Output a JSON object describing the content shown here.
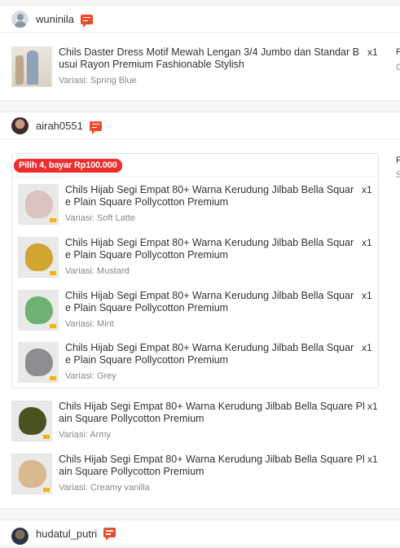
{
  "orders": [
    {
      "username": "wuninila",
      "side_label": "F",
      "side_sub": "C",
      "products": [
        {
          "name": "Chils Daster Dress Motif Mewah Lengan 3/4 Jumbo dan Standar Busui Rayon Premium Fashionable Stylish",
          "name_line1": "Chils Daster Dress Motif Mewah Lengan 3/4 Jumbo dan Standar B",
          "name_line2": "usui Rayon Premium Fashionable Stylish",
          "variant": "Variasi: Spring Blue",
          "qty": "x1",
          "color": "#8fa2b6"
        }
      ]
    },
    {
      "username": "airah0551",
      "side_label": "F",
      "side_sub": "S",
      "bundle": {
        "tag": "Pilih 4, bayar Rp100.000",
        "products": [
          {
            "name_line1": "Chils Hijab Segi Empat 80+ Warna Kerudung Jilbab Bella Squar",
            "name_line2": "e Plain Square Pollycotton Premium",
            "variant": "Variasi: Soft Latte",
            "qty": "x1",
            "color": "#d9c3bc"
          },
          {
            "name_line1": "Chils Hijab Segi Empat 80+ Warna Kerudung Jilbab Bella Squar",
            "name_line2": "e Plain Square Pollycotton Premium",
            "variant": "Variasi: Mustard",
            "qty": "x1",
            "color": "#d1a531"
          },
          {
            "name_line1": "Chils Hijab Segi Empat 80+ Warna Kerudung Jilbab Bella Squar",
            "name_line2": "e Plain Square Pollycotton Premium",
            "variant": "Variasi: Mint",
            "qty": "x1",
            "color": "#6fb174"
          },
          {
            "name_line1": "Chils Hijab Segi Empat 80+ Warna Kerudung Jilbab Bella Squar",
            "name_line2": "e Plain Square Pollycotton Premium",
            "variant": "Variasi: Grey",
            "qty": "x1",
            "color": "#8b8d90"
          }
        ]
      },
      "products": [
        {
          "name_line1": "Chils Hijab Segi Empat 80+ Warna Kerudung Jilbab Bella Square Pl",
          "name_line2": "ain Square Pollycotton Premium",
          "variant": "Variasi: Army",
          "qty": "x1",
          "color": "#4a5320"
        },
        {
          "name_line1": "Chils Hijab Segi Empat 80+ Warna Kerudung Jilbab Bella Square Pl",
          "name_line2": "ain Square Pollycotton Premium",
          "variant": "Variasi: Creamy vanilla",
          "qty": "x1",
          "color": "#d9b98f"
        }
      ]
    },
    {
      "username": "hudatul_putri"
    }
  ],
  "colors": {
    "accent": "#ee4d2d",
    "bundle_tag": "#ee2d2d"
  }
}
